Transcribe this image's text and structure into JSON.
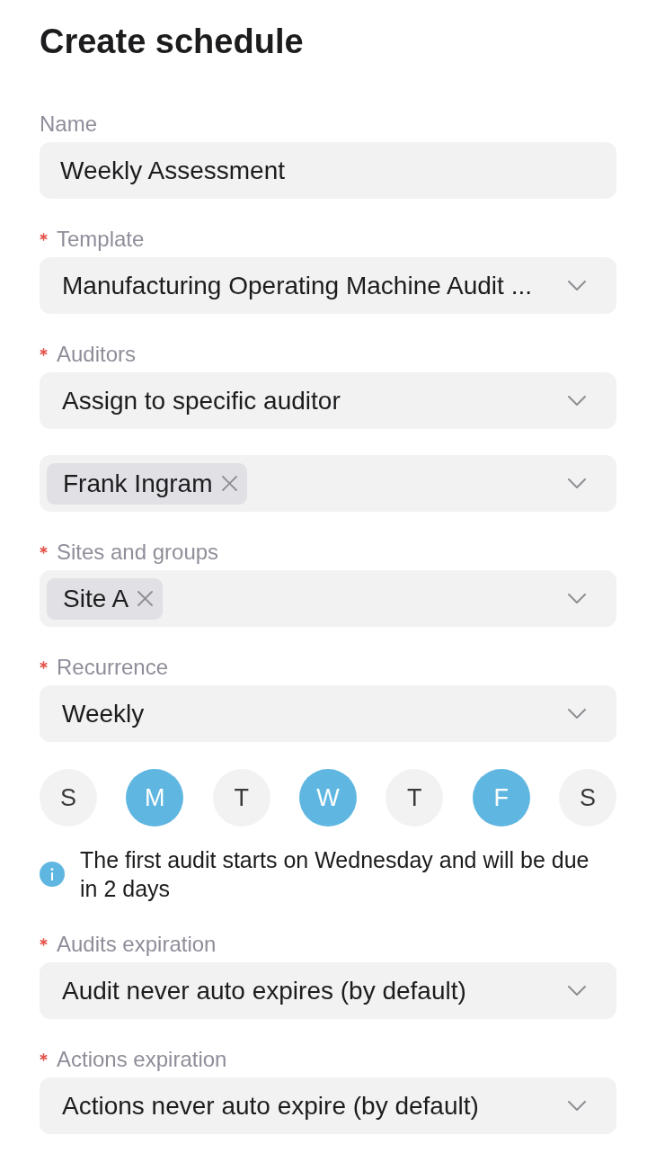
{
  "title": "Create schedule",
  "fields": [
    {
      "kind": "text",
      "label": "Name",
      "required": false,
      "value": "Weekly Assessment"
    },
    {
      "kind": "select",
      "label": "Template",
      "required": true,
      "value": "Manufacturing Operating Machine Audit ..."
    },
    {
      "kind": "select",
      "label": "Auditors",
      "required": true,
      "value": "Assign to specific auditor"
    },
    {
      "kind": "multiselect",
      "chips": [
        "Frank Ingram"
      ]
    },
    {
      "kind": "multiselect",
      "label": "Sites and groups",
      "required": true,
      "chips": [
        "Site A"
      ]
    },
    {
      "kind": "select",
      "label": "Recurrence",
      "required": true,
      "value": "Weekly"
    },
    {
      "kind": "days",
      "days": [
        {
          "label": "S",
          "selected": false
        },
        {
          "label": "M",
          "selected": true
        },
        {
          "label": "T",
          "selected": false
        },
        {
          "label": "W",
          "selected": true
        },
        {
          "label": "T",
          "selected": false
        },
        {
          "label": "F",
          "selected": true
        },
        {
          "label": "S",
          "selected": false
        }
      ]
    },
    {
      "kind": "info",
      "text": "The first audit starts on Wednesday and will be due in 2 days"
    },
    {
      "kind": "select",
      "label": "Audits expiration",
      "required": true,
      "value": "Audit never auto expires (by default)"
    },
    {
      "kind": "select",
      "label": "Actions expiration",
      "required": true,
      "value": "Actions never auto expire (by default)"
    }
  ]
}
